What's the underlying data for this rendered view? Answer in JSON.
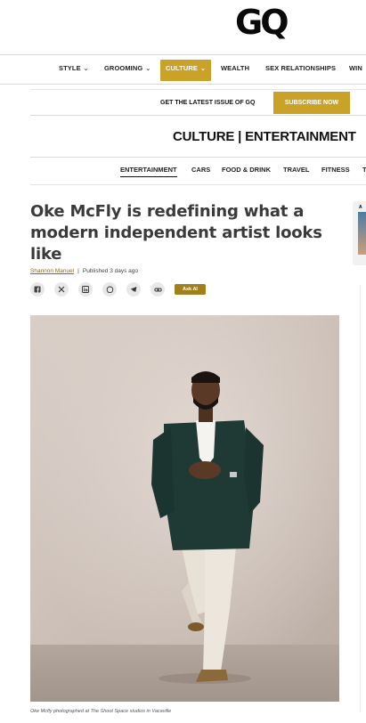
{
  "logo": {
    "text": "GQ"
  },
  "nav": {
    "items": [
      {
        "label": "STYLE",
        "chevron": true
      },
      {
        "label": "GROOMING",
        "chevron": true
      },
      {
        "label": "CULTURE",
        "chevron": true,
        "active": true
      },
      {
        "label": "WEALTH",
        "chevron": false
      },
      {
        "label": "SEX RELATIONSHIPS",
        "chevron": false
      },
      {
        "label": "WIN",
        "chevron": false
      }
    ]
  },
  "promo": {
    "text": "GET THE LATEST ISSUE OF GQ",
    "subscribe_label": "SUBSCRIBE NOW"
  },
  "section": {
    "title": "CULTURE | ENTERTAINMENT"
  },
  "subnav": {
    "items": [
      "ENTERTAINMENT",
      "CARS",
      "FOOD & DRINK",
      "TRAVEL",
      "FITNESS",
      "T"
    ],
    "active": "ENTERTAINMENT"
  },
  "article": {
    "headline": "Oke McFly is redefining what a modern independent artist looks like",
    "author": "Shannon Manuel",
    "separator": "|",
    "published": "Published 3 days ago",
    "ask_ai_label": "Ask AI",
    "caption": "Oke Mcfly photographed at The Shoot Space studios in Vacaville"
  },
  "share_icons": [
    "facebook-icon",
    "x-icon",
    "linkedin-icon",
    "whatsapp-icon",
    "telegram-icon",
    "link-icon"
  ],
  "side_ad": {
    "letter": "A"
  },
  "colors": {
    "gold": "#c9a227",
    "ask_ai": "#a07f1c",
    "headline": "#3a3a3a"
  }
}
